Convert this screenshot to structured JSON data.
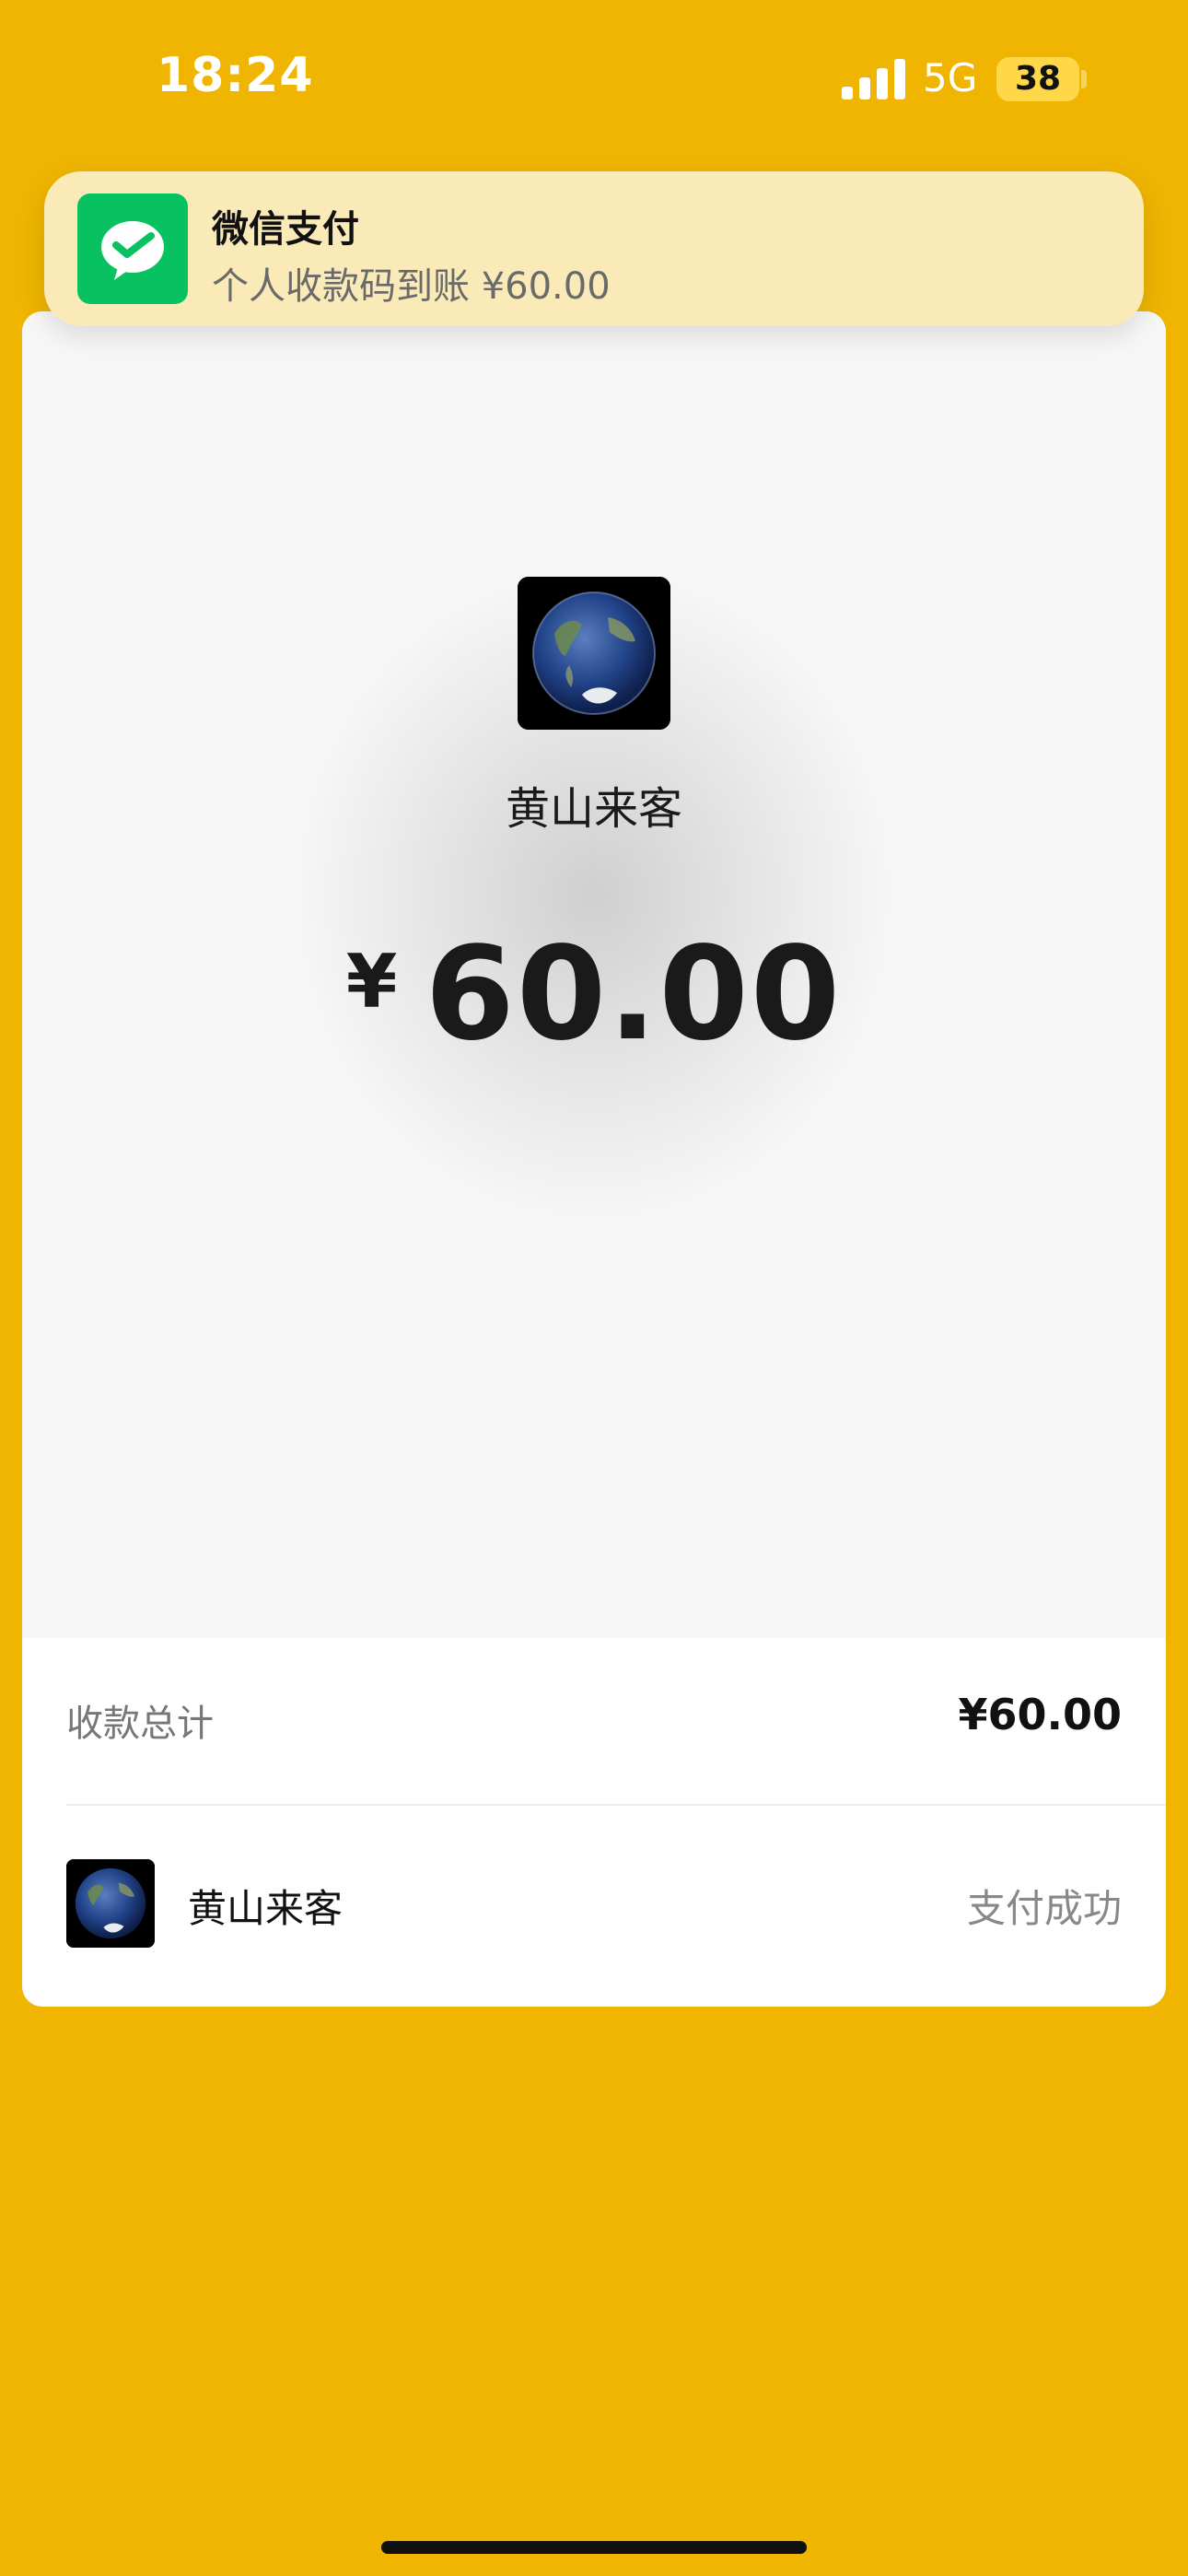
{
  "status_bar": {
    "time": "18:24",
    "network": "5G",
    "battery": "38"
  },
  "notification": {
    "app_name": "微信支付",
    "message": "个人收款码到账 ¥60.00",
    "icon": "wechat-pay-icon"
  },
  "receipt": {
    "payer_name": "黄山来客",
    "currency_symbol": "¥",
    "amount": "60.00",
    "avatar_icon": "earth-globe-avatar"
  },
  "summary": {
    "total_label": "收款总计",
    "total_value": "¥60.00"
  },
  "records": [
    {
      "name": "黄山来客",
      "status": "支付成功"
    }
  ],
  "colors": {
    "background": "#EFB500",
    "wechat_green": "#08C160",
    "notification_bg": "#FAEAB8"
  }
}
